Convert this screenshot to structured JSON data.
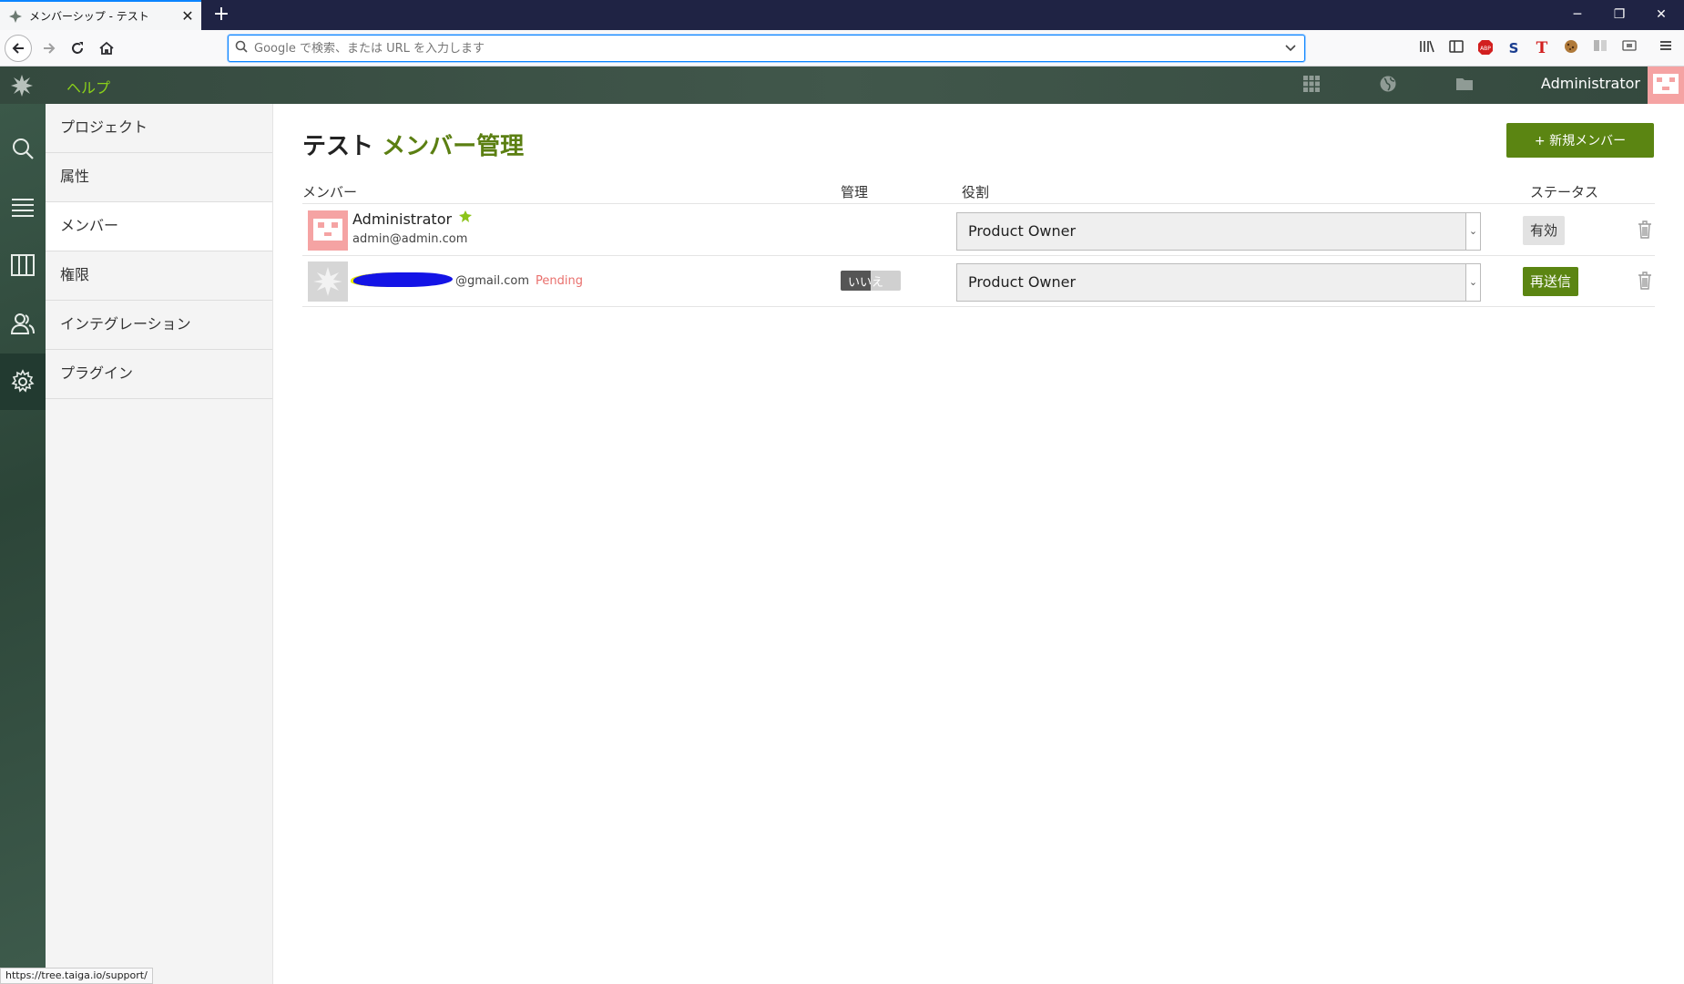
{
  "browser": {
    "tab_title": "メンバーシップ - テスト",
    "tab_close": "✕",
    "new_tab": "+",
    "url_placeholder": "Google で検索、または URL を入力します",
    "window_controls": {
      "minimize": "─",
      "maximize": "❐",
      "close": "✕"
    },
    "status_url": "https://tree.taiga.io/support/"
  },
  "header": {
    "help_label": "ヘルプ",
    "username": "Administrator"
  },
  "submenu": {
    "items": [
      {
        "label": "プロジェクト",
        "active": false
      },
      {
        "label": "属性",
        "active": false
      },
      {
        "label": "メンバー",
        "active": true
      },
      {
        "label": "権限",
        "active": false
      },
      {
        "label": "インテグレーション",
        "active": false
      },
      {
        "label": "プラグイン",
        "active": false
      }
    ]
  },
  "page": {
    "project_name": "テスト",
    "section_title": "メンバー管理",
    "new_member_button": "+ 新規メンバー"
  },
  "table": {
    "headers": {
      "member": "メンバー",
      "admin": "管理",
      "role": "役割",
      "status": "ステータス"
    },
    "rows": [
      {
        "name": "Administrator",
        "email": "admin@admin.com",
        "role": "Product Owner",
        "status_label": "有効"
      },
      {
        "email_suffix": "@gmail.com",
        "pending_label": "Pending",
        "admin_toggle_label": "いいえ",
        "role": "Product Owner",
        "status_label": "再送信"
      }
    ]
  },
  "colors": {
    "accent_green": "#5b8512",
    "help_green": "#8bd11a",
    "pending_red": "#e9706d",
    "header_bg": "#3a4f45"
  }
}
